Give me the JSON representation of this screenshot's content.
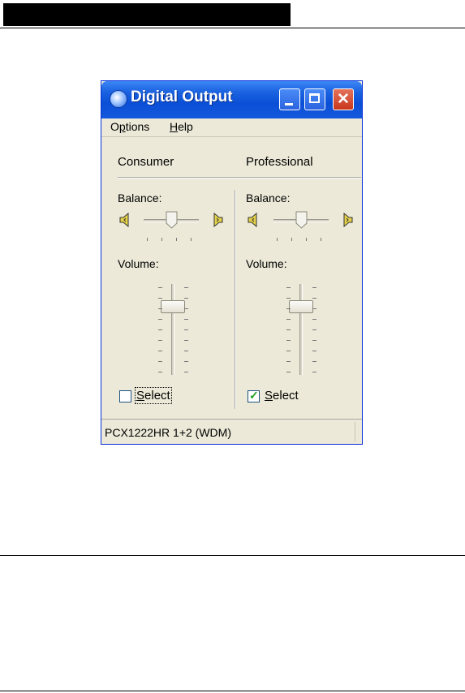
{
  "window": {
    "title": "Digital Output",
    "status_text": "PCX1222HR 1+2 (WDM)"
  },
  "menu": {
    "options": {
      "pre": "O",
      "accel": "p",
      "post": "tions"
    },
    "help": {
      "accel": "H",
      "post": "elp"
    }
  },
  "consumer": {
    "header": "Consumer",
    "balance_label": "Balance:",
    "volume_label": "Volume:",
    "select": {
      "accel": "S",
      "post": "elect",
      "checked": false
    },
    "balance_value": 0.5,
    "volume_value": 0.75
  },
  "professional": {
    "header": "Professional",
    "balance_label": "Balance:",
    "volume_label": "Volume:",
    "select": {
      "accel": "S",
      "post": "elect",
      "checked": true
    },
    "balance_value": 0.5,
    "volume_value": 0.75
  },
  "icons": {
    "title": "speaker-swirl-icon",
    "speaker": "speaker-icon",
    "checkmark": "✓"
  },
  "colors": {
    "titlebar": "#0a4fd6",
    "close_button": "#c8371c",
    "window_face": "#ece9d8"
  }
}
